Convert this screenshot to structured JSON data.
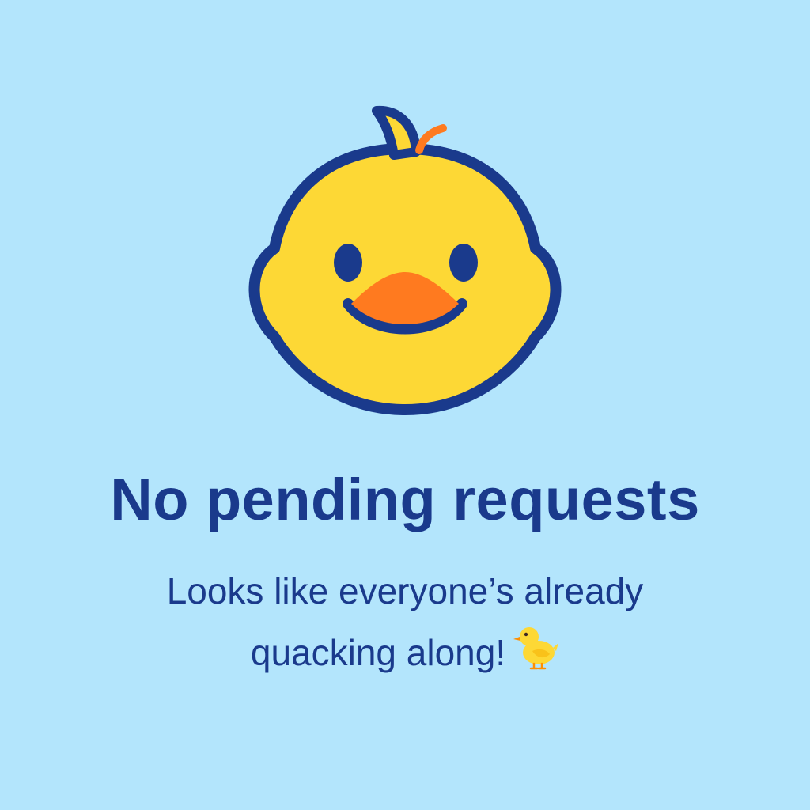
{
  "empty_state": {
    "illustration": "duck-face-icon",
    "title": "No pending requests",
    "message_line1": "Looks like everyone’s already",
    "message_line2": "quacking along!",
    "message_emoji": "baby-chick-icon"
  },
  "colors": {
    "background": "#b3e5fc",
    "text": "#1a3a8c",
    "duck_body": "#fdd835",
    "duck_outline": "#1a3a8c",
    "beak": "#ff7a1f"
  }
}
